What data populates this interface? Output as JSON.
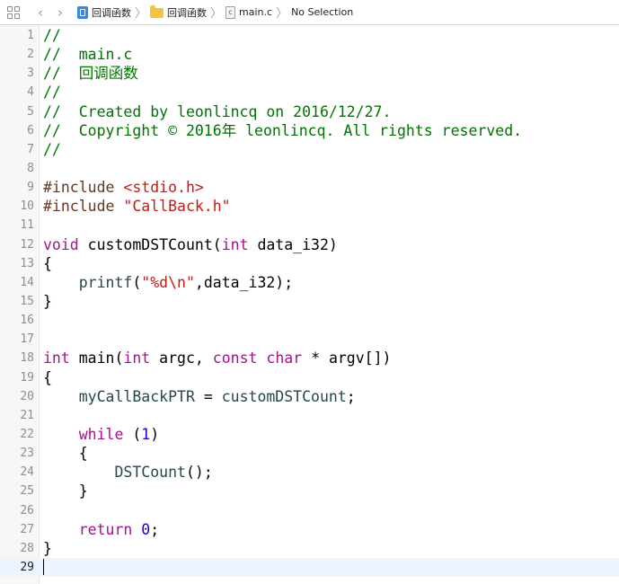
{
  "jumpbar": {
    "back_label": "‹",
    "forward_label": "›",
    "crumbs": [
      {
        "label": "回调函数",
        "icon": "project-icon"
      },
      {
        "label": "回调函数",
        "icon": "folder-icon"
      },
      {
        "label": "main.c",
        "icon": "c-file-icon",
        "file_letter": "c"
      },
      {
        "label": "No Selection",
        "icon": "none"
      }
    ],
    "separator": "〉"
  },
  "editor": {
    "current_line": 29,
    "colors": {
      "comment": "#007400",
      "preprocessor": "#643820",
      "string": "#c41a16",
      "keyword": "#aa0d91",
      "number": "#1c00cf",
      "identifier": "#26474b",
      "current_line_bg": "#ecf5ff"
    },
    "lines": [
      [
        {
          "t": "comment",
          "v": "//"
        }
      ],
      [
        {
          "t": "comment",
          "v": "//  main.c"
        }
      ],
      [
        {
          "t": "comment",
          "v": "//  回调函数"
        }
      ],
      [
        {
          "t": "comment",
          "v": "//"
        }
      ],
      [
        {
          "t": "comment",
          "v": "//  Created by leonlincq on 2016/12/27."
        }
      ],
      [
        {
          "t": "comment",
          "v": "//  Copyright © 2016年 leonlincq. All rights reserved."
        }
      ],
      [
        {
          "t": "comment",
          "v": "//"
        }
      ],
      [],
      [
        {
          "t": "pre",
          "v": "#include "
        },
        {
          "t": "str",
          "v": "<stdio.h>"
        }
      ],
      [
        {
          "t": "pre",
          "v": "#include "
        },
        {
          "t": "str",
          "v": "\"CallBack.h\""
        }
      ],
      [],
      [
        {
          "t": "kw",
          "v": "void"
        },
        {
          "t": "plain",
          "v": " customDSTCount("
        },
        {
          "t": "kw",
          "v": "int"
        },
        {
          "t": "plain",
          "v": " data_i32)"
        }
      ],
      [
        {
          "t": "plain",
          "v": "{"
        }
      ],
      [
        {
          "t": "plain",
          "v": "    "
        },
        {
          "t": "fn",
          "v": "printf"
        },
        {
          "t": "plain",
          "v": "("
        },
        {
          "t": "str",
          "v": "\"%d\\n\""
        },
        {
          "t": "plain",
          "v": ",data_i32);"
        }
      ],
      [
        {
          "t": "plain",
          "v": "}"
        }
      ],
      [],
      [],
      [
        {
          "t": "kw",
          "v": "int"
        },
        {
          "t": "plain",
          "v": " main("
        },
        {
          "t": "kw",
          "v": "int"
        },
        {
          "t": "plain",
          "v": " argc, "
        },
        {
          "t": "kw",
          "v": "const"
        },
        {
          "t": "plain",
          "v": " "
        },
        {
          "t": "kw",
          "v": "char"
        },
        {
          "t": "plain",
          "v": " * argv[])"
        }
      ],
      [
        {
          "t": "plain",
          "v": "{"
        }
      ],
      [
        {
          "t": "plain",
          "v": "    "
        },
        {
          "t": "fn",
          "v": "myCallBackPTR"
        },
        {
          "t": "plain",
          "v": " = "
        },
        {
          "t": "fn",
          "v": "customDSTCount"
        },
        {
          "t": "plain",
          "v": ";"
        }
      ],
      [],
      [
        {
          "t": "plain",
          "v": "    "
        },
        {
          "t": "kw",
          "v": "while"
        },
        {
          "t": "plain",
          "v": " ("
        },
        {
          "t": "num",
          "v": "1"
        },
        {
          "t": "plain",
          "v": ")"
        }
      ],
      [
        {
          "t": "plain",
          "v": "    {"
        }
      ],
      [
        {
          "t": "plain",
          "v": "        "
        },
        {
          "t": "fn",
          "v": "DSTCount"
        },
        {
          "t": "plain",
          "v": "();"
        }
      ],
      [
        {
          "t": "plain",
          "v": "    }"
        }
      ],
      [],
      [
        {
          "t": "plain",
          "v": "    "
        },
        {
          "t": "kw",
          "v": "return"
        },
        {
          "t": "plain",
          "v": " "
        },
        {
          "t": "num",
          "v": "0"
        },
        {
          "t": "plain",
          "v": ";"
        }
      ],
      [
        {
          "t": "plain",
          "v": "}"
        }
      ],
      []
    ]
  }
}
